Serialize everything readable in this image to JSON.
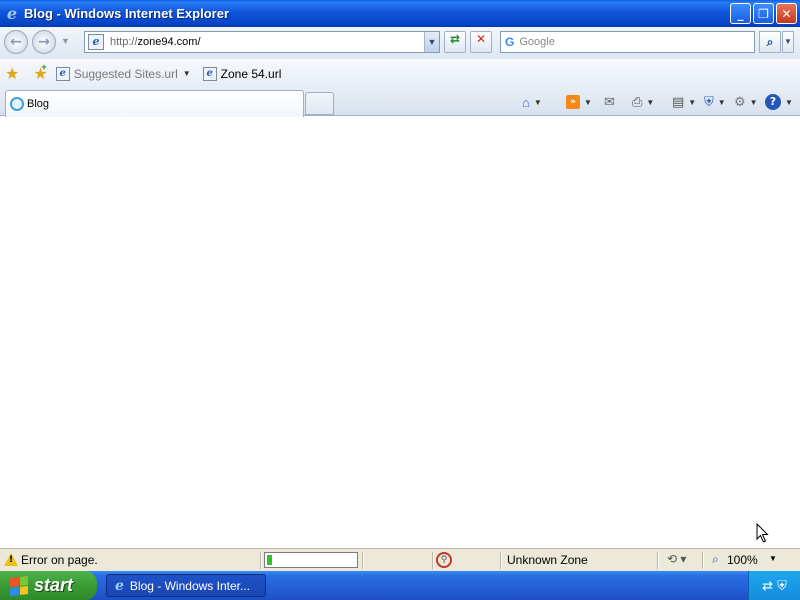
{
  "window": {
    "title": "Blog - Windows Internet Explorer",
    "buttons": {
      "minimize": "_",
      "restore": "❐",
      "close": "✕"
    }
  },
  "navbar": {
    "back": "←",
    "forward": "→",
    "url_prefix": "http://",
    "url_host": "zone94.com/",
    "refresh": "⇄",
    "stop": "✕",
    "search_placeholder": "Google",
    "search_engine_glyph": "G",
    "search_go": "⌕"
  },
  "favorites_bar": {
    "items": [
      {
        "label": "Suggested Sites.url",
        "has_dropdown": true,
        "dimmed": true
      },
      {
        "label": "Zone 54.url",
        "has_dropdown": false,
        "dimmed": false
      }
    ]
  },
  "tabs": [
    {
      "label": "Blog",
      "active": true
    }
  ],
  "command_bar": {
    "icons": [
      "home-icon",
      "feeds-icon",
      "read-mail-icon",
      "print-icon",
      "page-icon",
      "safety-icon",
      "tools-icon",
      "help-icon"
    ]
  },
  "status_bar": {
    "message": "Error on page.",
    "progress": 0.06,
    "zone": "Unknown Zone",
    "zoom": "100%"
  },
  "taskbar": {
    "start_label": "start",
    "task_item": "Blog - Windows Inter..."
  },
  "colors": {
    "titlebar": "#0a55da",
    "taskbar": "#245fd8",
    "start_button": "#3a9b35",
    "progress_fill": "#2fc22f"
  }
}
